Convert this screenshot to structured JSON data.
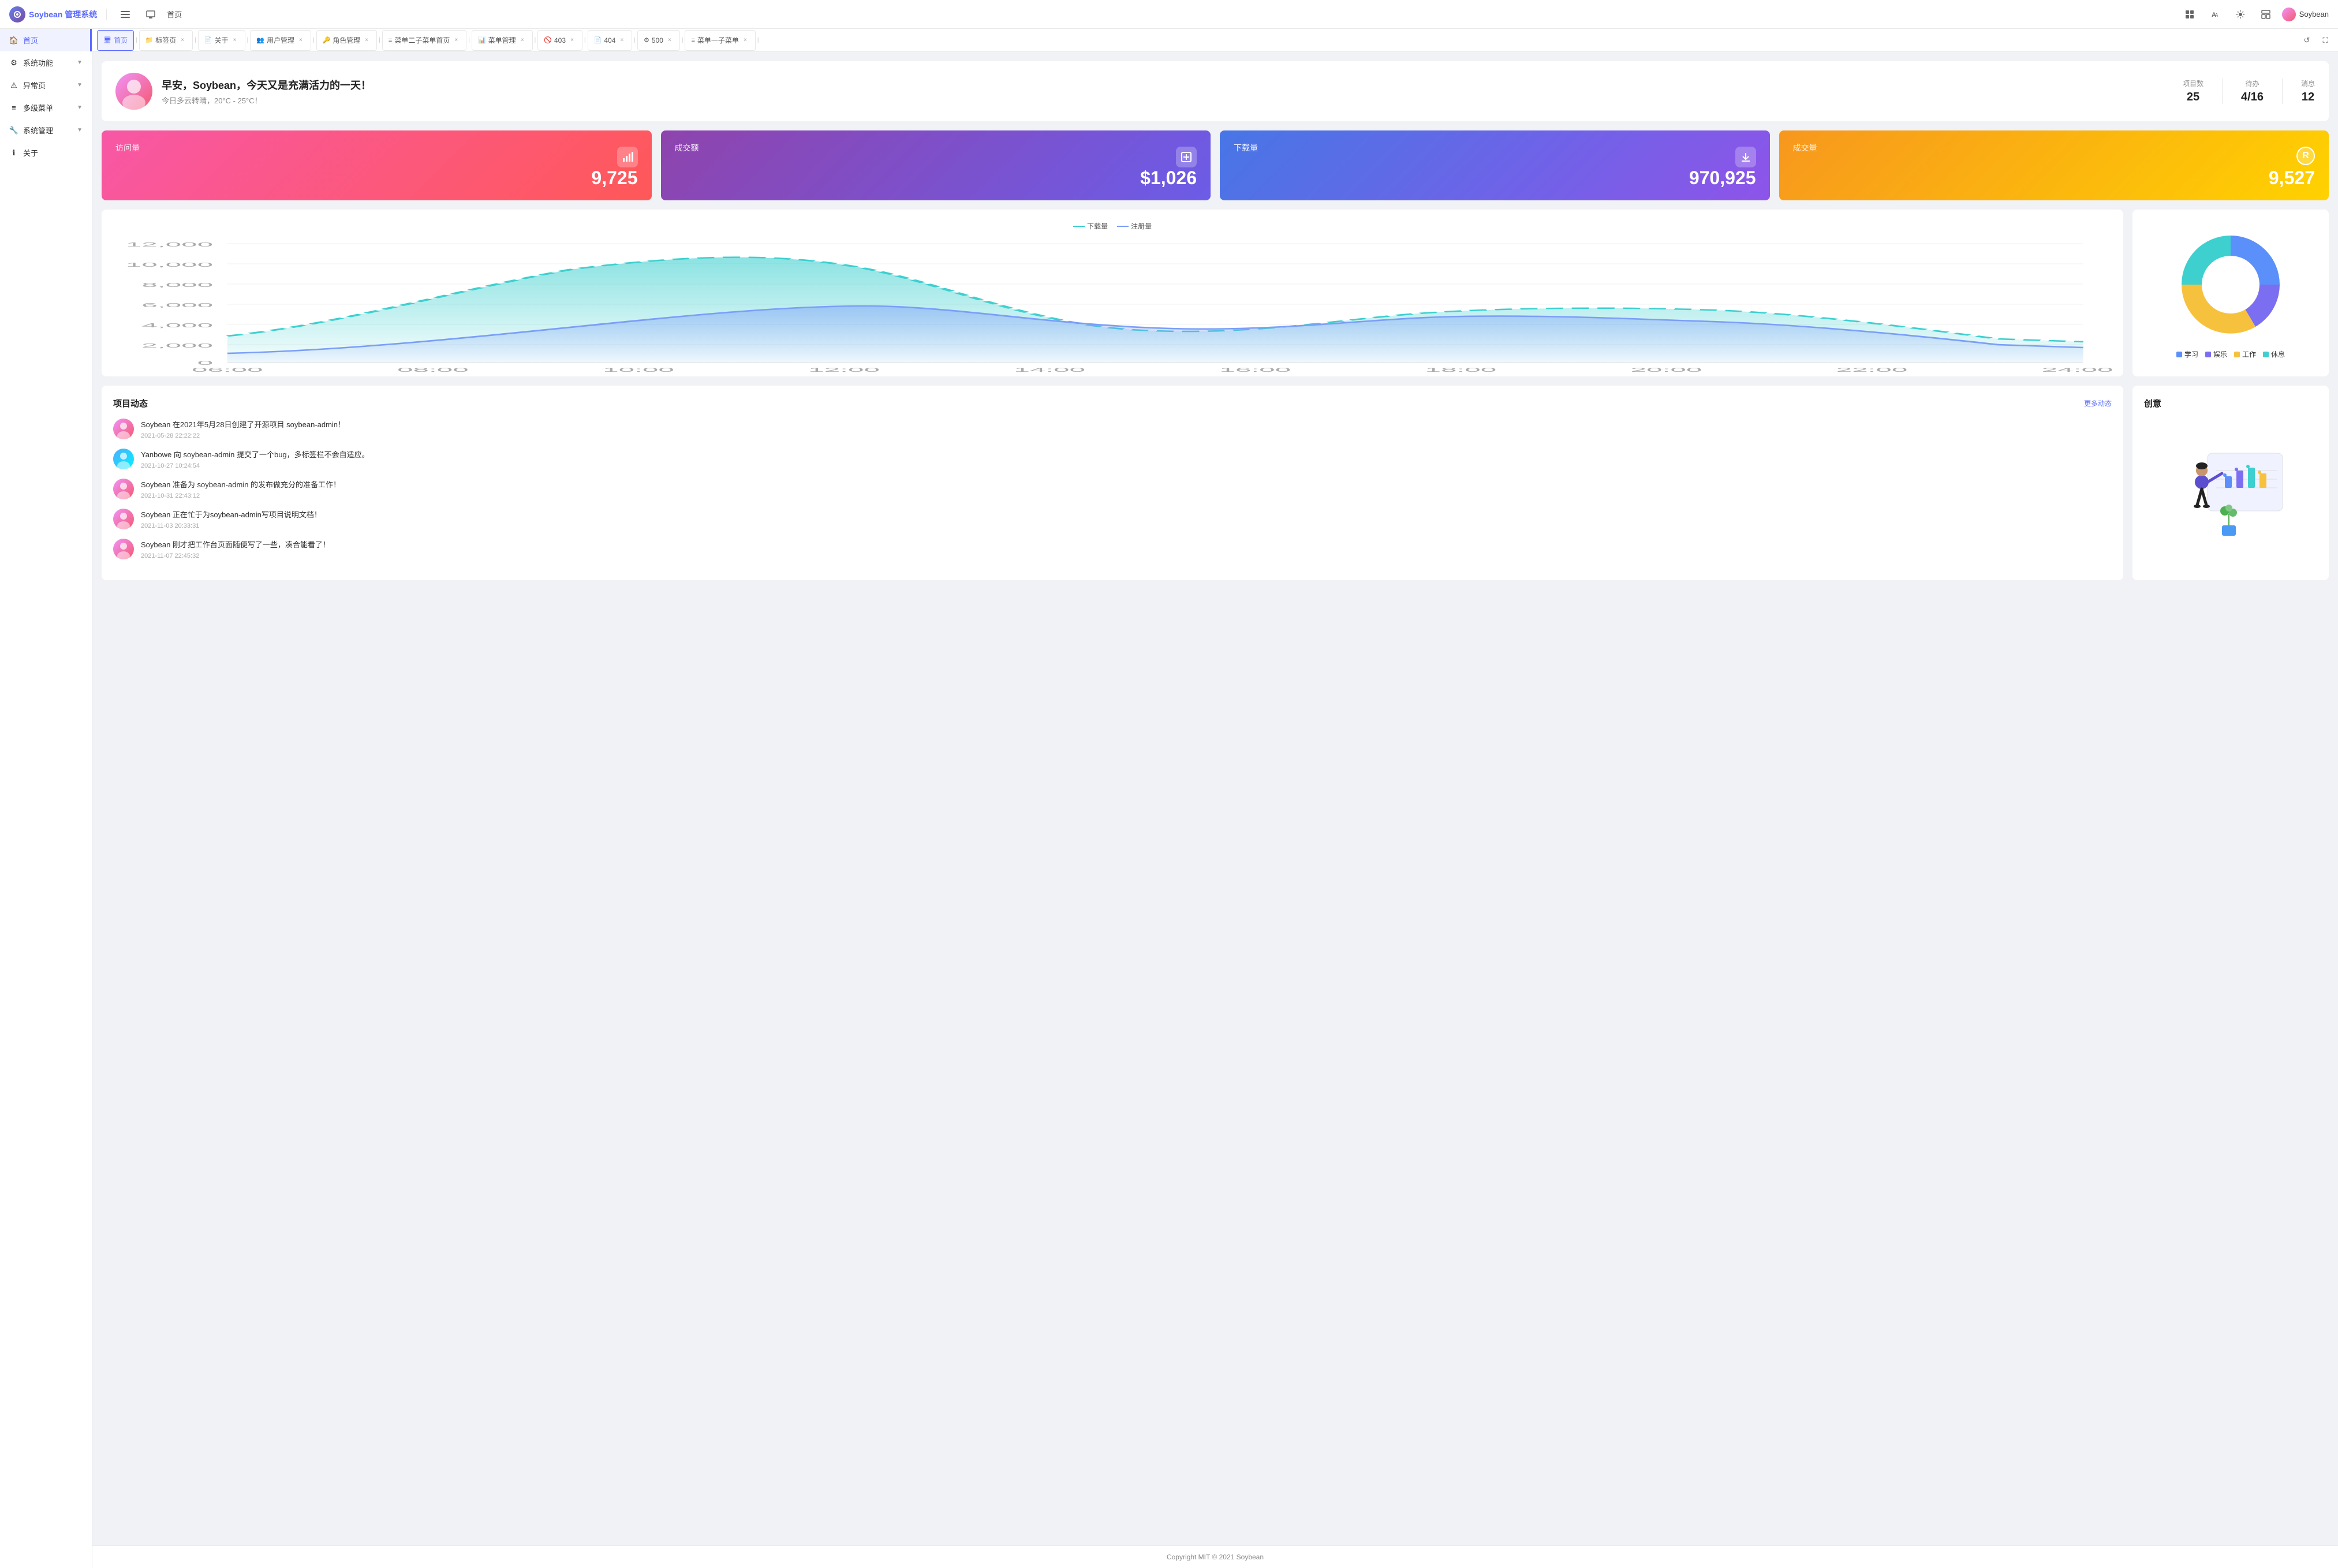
{
  "app": {
    "logo_text": "Soybean 管理系统",
    "nav_icon1": "☰",
    "nav_icon2": "🖥",
    "nav_home": "首页",
    "user_name": "Soybean"
  },
  "tabs": [
    {
      "label": "首页",
      "icon": "🖥",
      "active": true,
      "closable": false
    },
    {
      "label": "标签页",
      "icon": "📁",
      "active": false,
      "closable": true
    },
    {
      "label": "关于",
      "icon": "📄",
      "active": false,
      "closable": true
    },
    {
      "label": "用户管理",
      "icon": "👥",
      "active": false,
      "closable": true
    },
    {
      "label": "角色管理",
      "icon": "🔑",
      "active": false,
      "closable": true
    },
    {
      "label": "菜单二子菜单首页",
      "icon": "≡",
      "active": false,
      "closable": true
    },
    {
      "label": "菜单管理",
      "icon": "📊",
      "active": false,
      "closable": true
    },
    {
      "label": "403",
      "icon": "🚫",
      "active": false,
      "closable": true
    },
    {
      "label": "404",
      "icon": "📄",
      "active": false,
      "closable": true
    },
    {
      "label": "500",
      "icon": "⚙",
      "active": false,
      "closable": true
    },
    {
      "label": "菜单一子菜单",
      "icon": "≡",
      "active": false,
      "closable": true
    }
  ],
  "sidebar": {
    "items": [
      {
        "id": "home",
        "label": "首页",
        "icon": "🏠",
        "active": true,
        "hasChildren": false
      },
      {
        "id": "system",
        "label": "系统功能",
        "icon": "⚙",
        "active": false,
        "hasChildren": true
      },
      {
        "id": "exception",
        "label": "异常页",
        "icon": "⚠",
        "active": false,
        "hasChildren": true
      },
      {
        "id": "multimenu",
        "label": "多级菜单",
        "icon": "≡",
        "active": false,
        "hasChildren": true
      },
      {
        "id": "sysmanage",
        "label": "系统管理",
        "icon": "🔧",
        "active": false,
        "hasChildren": true
      },
      {
        "id": "about",
        "label": "关于",
        "icon": "ℹ",
        "active": false,
        "hasChildren": false
      }
    ]
  },
  "welcome": {
    "greeting": "早安，Soybean，今天又是充满活力的一天！",
    "weather": "今日多云转晴，20°C - 25°C！",
    "stats": {
      "projects_label": "项目数",
      "projects_value": "25",
      "pending_label": "待办",
      "pending_value": "4/16",
      "messages_label": "消息",
      "messages_value": "12"
    }
  },
  "metrics": [
    {
      "label": "访问量",
      "value": "9,725",
      "icon": "📊",
      "class": "card-visits"
    },
    {
      "label": "成交额",
      "value": "$1,026",
      "icon": "📥",
      "class": "card-transactions"
    },
    {
      "label": "下载量",
      "value": "970,925",
      "icon": "📤",
      "class": "card-downloads"
    },
    {
      "label": "成交量",
      "value": "9,527",
      "icon": "®",
      "class": "card-revenue"
    }
  ],
  "chart": {
    "legend": [
      {
        "label": "下载量",
        "color": "#3ecfcf",
        "line_style": "dashed"
      },
      {
        "label": "注册量",
        "color": "#7b9ef9",
        "line_style": "solid"
      }
    ],
    "x_labels": [
      "06:00",
      "08:00",
      "10:00",
      "12:00",
      "14:00",
      "16:00",
      "18:00",
      "20:00",
      "22:00",
      "24:00"
    ],
    "y_labels": [
      "0",
      "2,000",
      "4,000",
      "6,000",
      "8,000",
      "10,000",
      "12,000"
    ]
  },
  "donut": {
    "segments": [
      {
        "label": "学习",
        "color": "#5b8ff9",
        "value": 25
      },
      {
        "label": "娱乐",
        "color": "#7c6ef0",
        "value": 20
      },
      {
        "label": "工作",
        "color": "#f6c23e",
        "value": 30
      },
      {
        "label": "休息",
        "color": "#3ecfcf",
        "value": 25
      }
    ]
  },
  "activity": {
    "title": "项目动态",
    "more_label": "更多动态",
    "items": [
      {
        "user": "Soybean",
        "text": "Soybean 在2021年5月28日创建了开源项目 soybean-admin！",
        "time": "2021-05-28 22:22:22",
        "avatar_class": "av1"
      },
      {
        "user": "Yanbowe",
        "text": "Yanbowe 向 soybean-admin 提交了一个bug，多标签栏不会自适应。",
        "time": "2021-10-27 10:24:54",
        "avatar_class": "av2"
      },
      {
        "user": "Soybean",
        "text": "Soybean 准备为 soybean-admin 的发布做充分的准备工作！",
        "time": "2021-10-31 22:43:12",
        "avatar_class": "av1"
      },
      {
        "user": "Soybean",
        "text": "Soybean 正在忙于为soybean-admin写项目说明文档！",
        "time": "2021-11-03 20:33:31",
        "avatar_class": "av1"
      },
      {
        "user": "Soybean",
        "text": "Soybean 刚才把工作台页面随便写了一些，凑合能看了！",
        "time": "2021-11-07 22:45:32",
        "avatar_class": "av1"
      }
    ]
  },
  "creative": {
    "title": "创意"
  },
  "footer": {
    "text": "Copyright MIT © 2021 Soybean"
  }
}
